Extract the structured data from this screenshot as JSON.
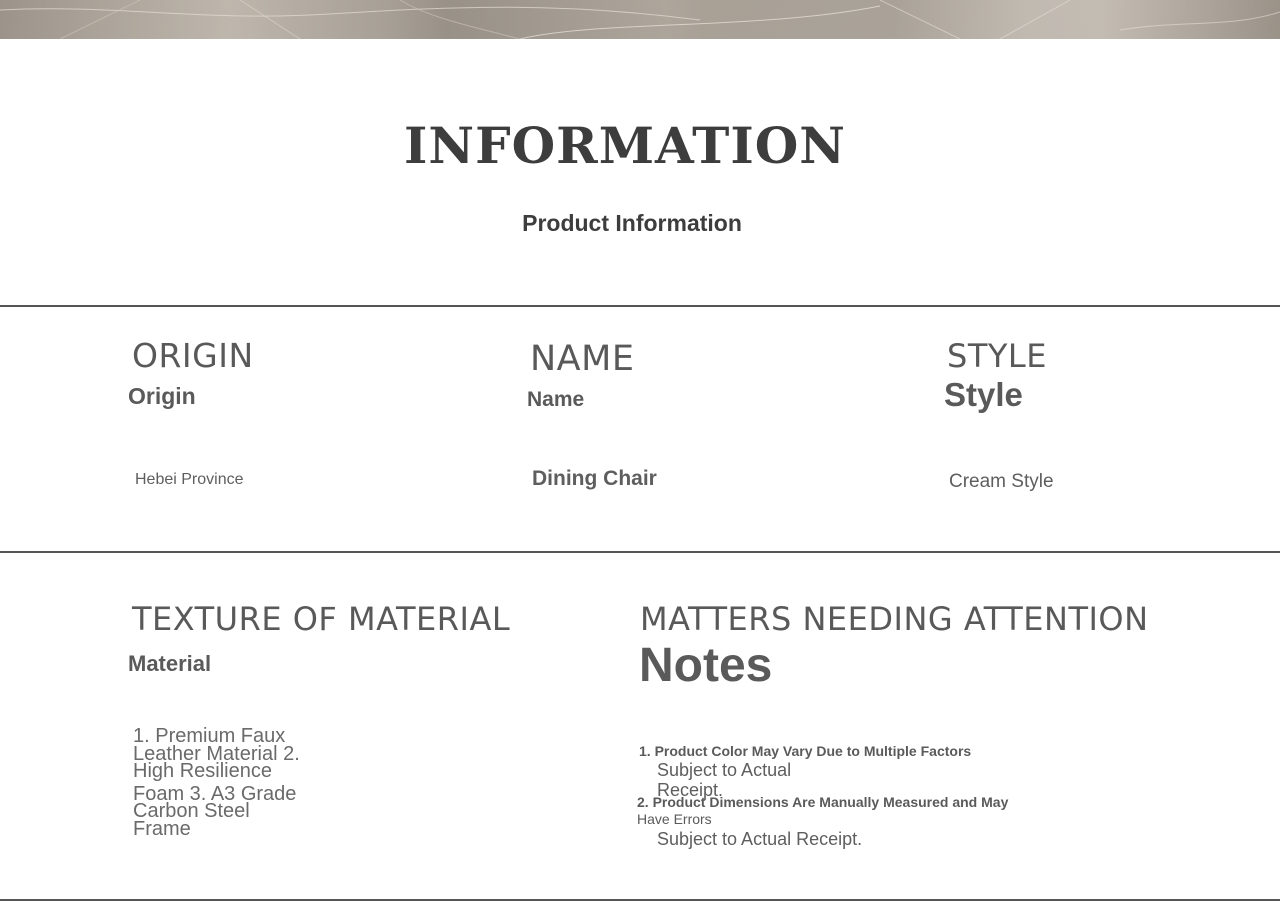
{
  "header": {
    "title": "INFORMATION",
    "subtitle": "Product Information"
  },
  "fields": {
    "origin": {
      "en": "ORIGIN",
      "label": "Origin",
      "value": "Hebei Province"
    },
    "name": {
      "en": "NAME",
      "label": "Name",
      "value": "Dining Chair"
    },
    "style": {
      "en": "STYLE",
      "label": "Style",
      "value": "Cream Style"
    },
    "material": {
      "en": "TEXTURE OF MATERIAL",
      "label": "Material",
      "value_lines": [
        "1. Premium Faux",
        "Leather Material 2.",
        "High Resilience",
        "Foam 3. A3 Grade",
        "Carbon Steel",
        "Frame"
      ]
    },
    "notes": {
      "en": "MATTERS NEEDING ATTENTION",
      "label": "Notes",
      "item1": "1. Product Color May Vary Due to Multiple Factors",
      "item1_sub_lines": [
        "Subject to Actual",
        "Receipt."
      ],
      "item2_lines": [
        "2. Product Dimensions Are Manually Measured and May",
        "Have Errors"
      ],
      "item2_sub": "Subject to Actual Receipt."
    }
  }
}
